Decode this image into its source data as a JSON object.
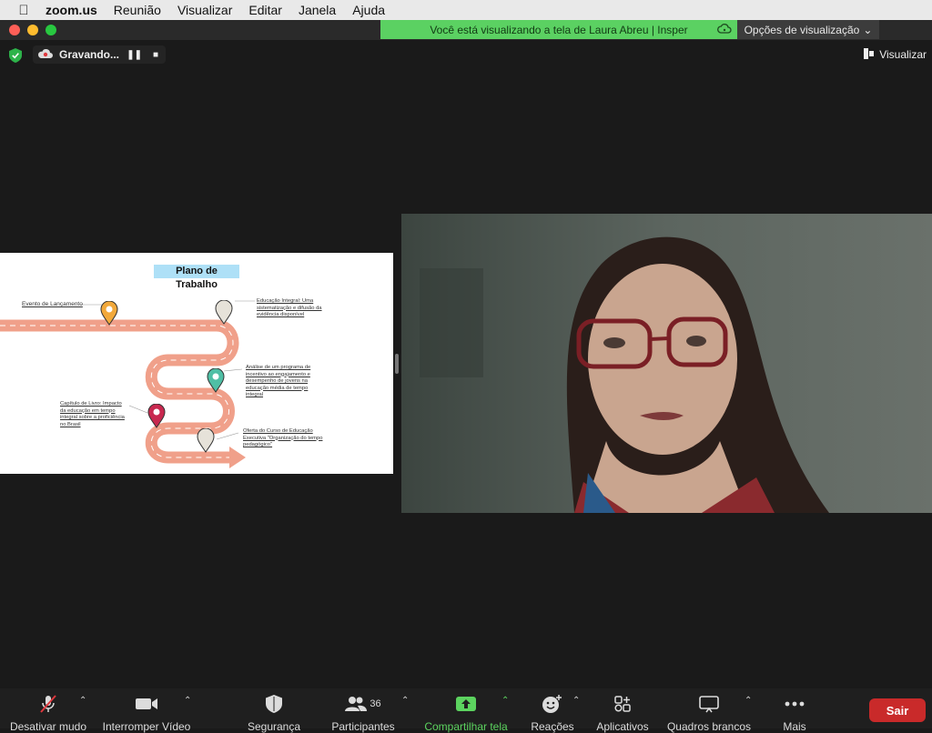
{
  "menubar": {
    "app_name": "zoom.us",
    "items": [
      "Reunião",
      "Visualizar",
      "Editar",
      "Janela",
      "Ajuda"
    ]
  },
  "share_banner": {
    "text": "Você está visualizando a tela de Laura Abreu | Insper",
    "view_options": "Opções de visualização"
  },
  "recording": {
    "label": "Gravando..."
  },
  "view_button": {
    "label": "Visualizar"
  },
  "slide": {
    "title": "Plano de Trabalho",
    "milestones": [
      {
        "text": "Evento de Lançamento",
        "pin_color": "#f2a93b"
      },
      {
        "text": "Educação Integral: Uma sistematização e difusão da evidência disponível",
        "pin_color": "#e6e2d9"
      },
      {
        "text": "Análise de um programa de incentivo ao engajamento e desempenho de jovens na educação média de tempo integral",
        "pin_color": "#4fbfa5"
      },
      {
        "text": "Capítulo de Livro: Impacto da educação em tempo integral sobre a proficiência no Brasil",
        "pin_color": "#c8284f"
      },
      {
        "text": "Oferta do Curso de Educação Executiva \"Organização do tempo pedagógico\"",
        "pin_color": "#e6e2d9"
      }
    ]
  },
  "toolbar": {
    "mute": "Desativar mudo",
    "video": "Interromper Vídeo",
    "security": "Segurança",
    "participants": "Participantes",
    "participants_count": "36",
    "share": "Compartilhar tela",
    "reactions": "Reações",
    "apps": "Aplicativos",
    "whiteboards": "Quadros brancos",
    "more": "Mais",
    "exit": "Sair"
  },
  "colors": {
    "banner_green": "#5bd162",
    "share_green": "#5cd35f",
    "exit_red": "#c92a2a",
    "road": "#f0a08a"
  }
}
